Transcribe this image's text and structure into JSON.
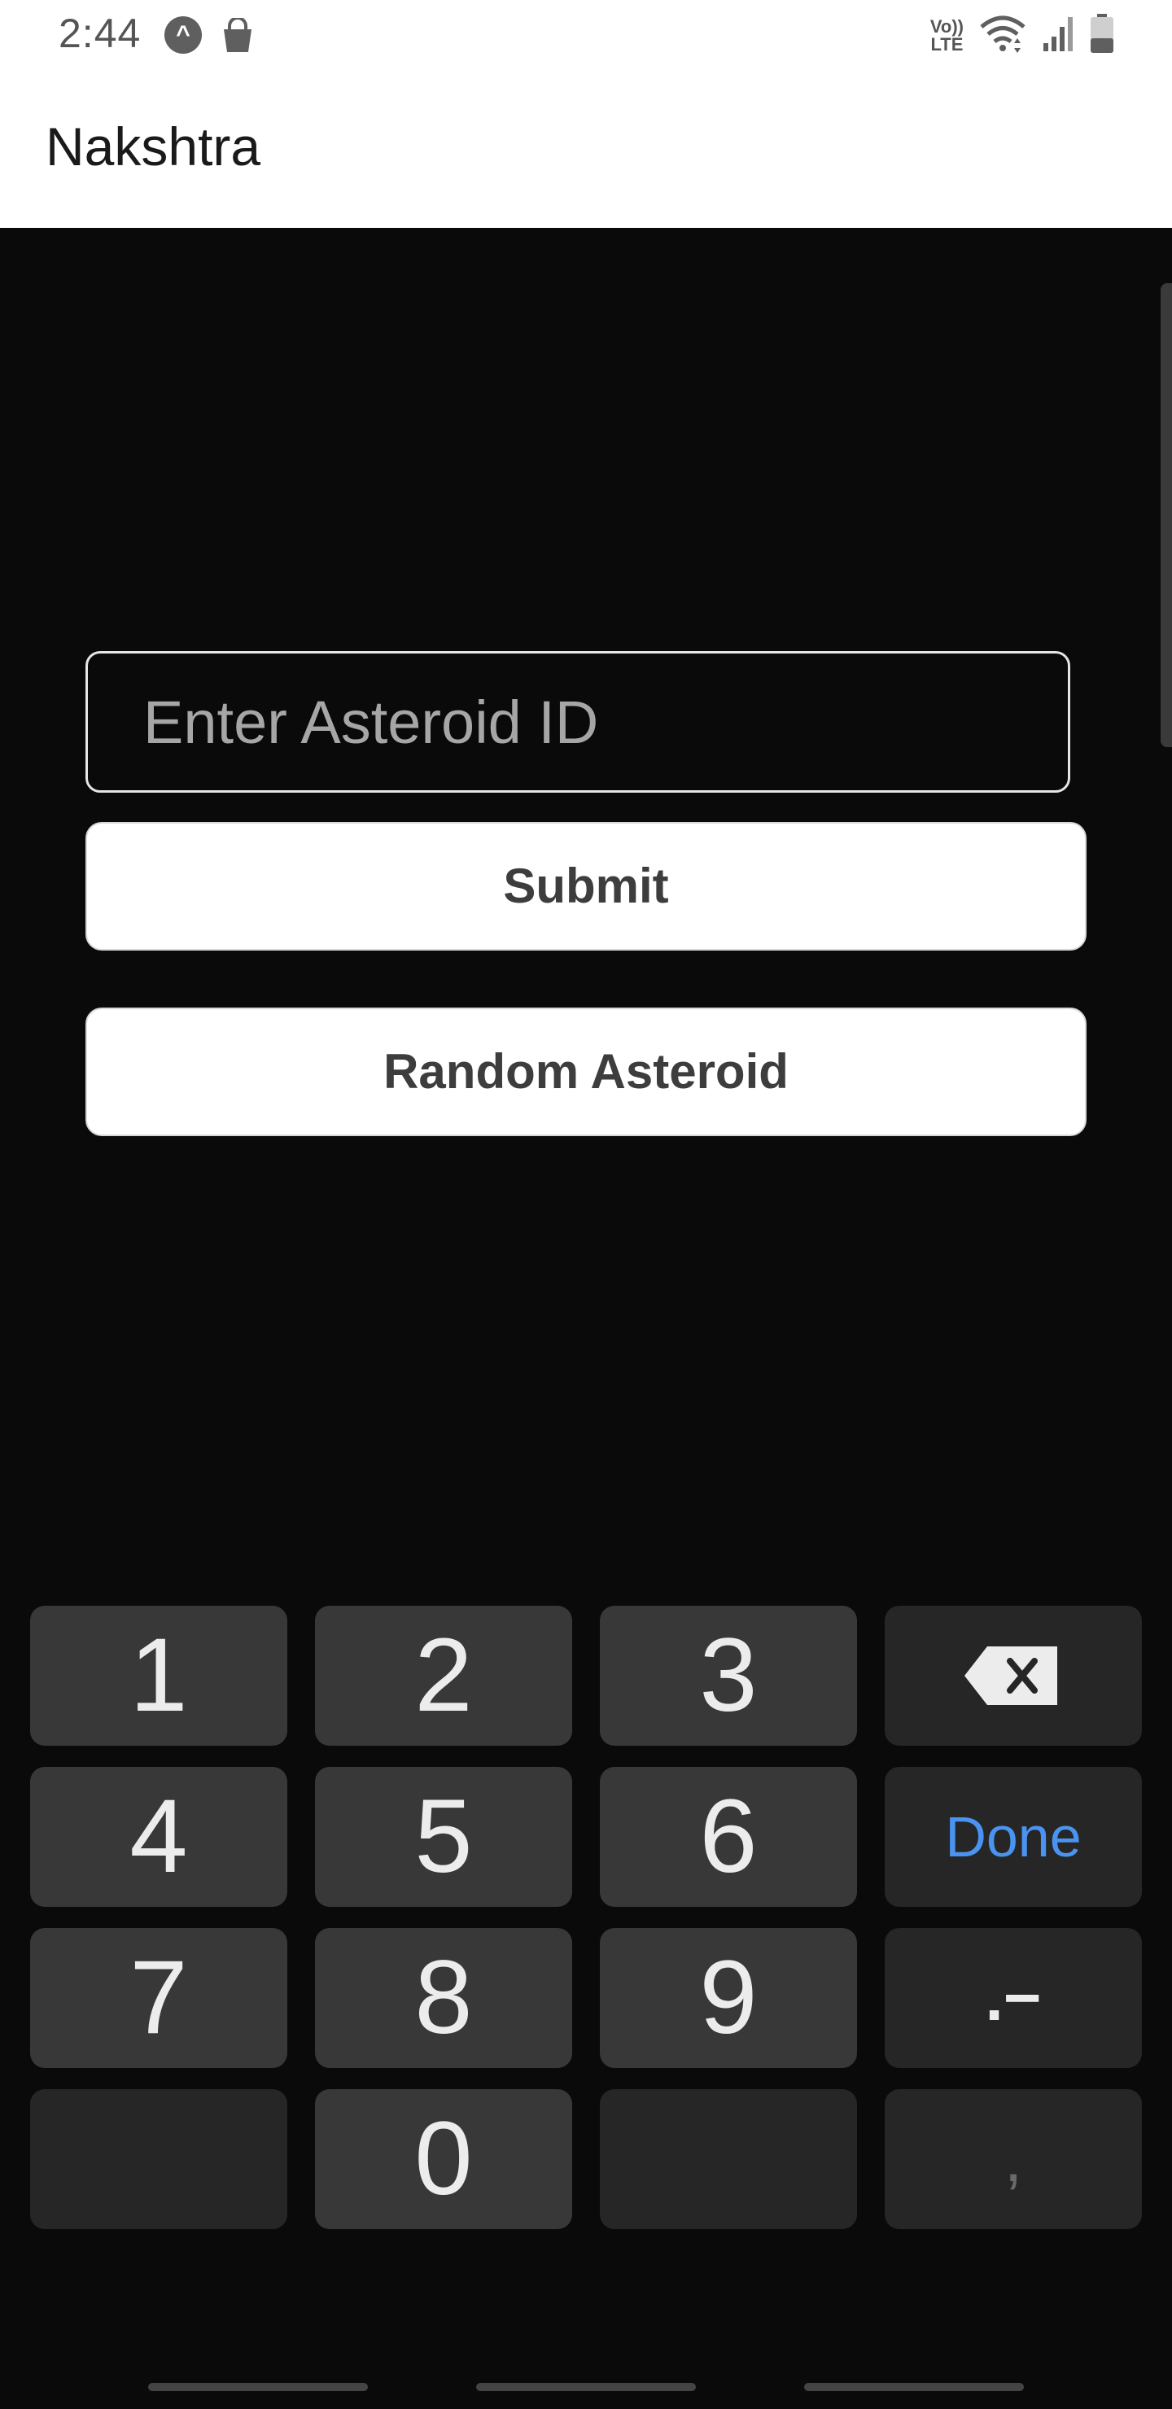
{
  "status_bar": {
    "time": "2:44",
    "app_icon_glyph": "^",
    "network_label_top": "Vo))",
    "network_label_bottom": "LTE",
    "icons": [
      "notification-app-icon",
      "shopping-bag-icon",
      "volte-icon",
      "wifi-icon",
      "signal-icon",
      "battery-icon"
    ]
  },
  "app_bar": {
    "title": "Nakshtra"
  },
  "form": {
    "input_placeholder": "Enter Asteroid ID",
    "input_value": "",
    "submit_label": "Submit",
    "random_label": "Random Asteroid"
  },
  "keyboard": {
    "row1": [
      "1",
      "2",
      "3"
    ],
    "row2": [
      "4",
      "5",
      "6"
    ],
    "row3": [
      "7",
      "8",
      "9"
    ],
    "row4": [
      "",
      "0",
      ""
    ],
    "done_label": "Done",
    "dot_dash_label": ".−",
    "comma_label": ",",
    "backspace_icon": "backspace-icon",
    "done_color": "#4a93f0"
  },
  "colors": {
    "background": "#0a0a0a",
    "key": "#383838",
    "function_key": "#262626",
    "app_bar": "#ffffff"
  }
}
